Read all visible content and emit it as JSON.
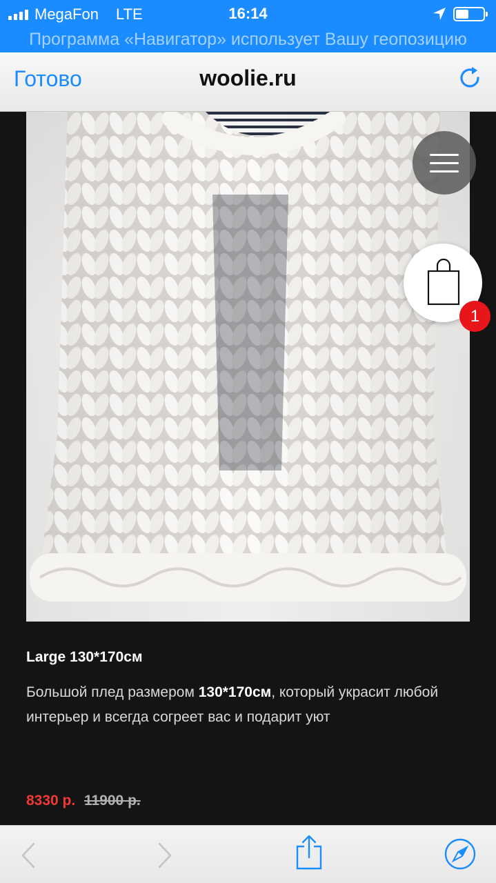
{
  "status_bar": {
    "carrier": "MegaFon",
    "network": "LTE",
    "time": "16:14"
  },
  "navigation_banner": "Программа «Навигатор» использует Вашу геопозицию",
  "browser": {
    "done_label": "Готово",
    "url": "woolie.ru"
  },
  "cart": {
    "badge_count": "1"
  },
  "product": {
    "title": "Large 130*170см",
    "description_before": "Большой плед размером ",
    "description_bold": "130*170см",
    "description_after": ", который украсит любой интерьер и всегда согреет вас и подарит уют",
    "price": "8330 р.",
    "old_price": "11900 р."
  },
  "colors": {
    "accent": "#1a8cff",
    "price": "#f03a32",
    "badge": "#e8161b",
    "background": "#141414"
  }
}
